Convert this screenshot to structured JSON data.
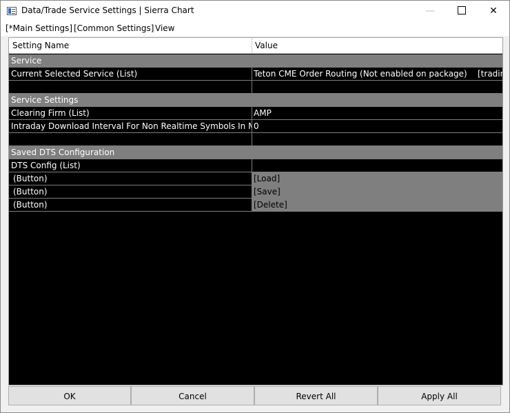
{
  "window": {
    "title": "Data/Trade Service Settings | Sierra Chart"
  },
  "menu": {
    "main_settings": "[*Main Settings]",
    "common_settings": "[Common Settings]",
    "view": "View"
  },
  "grid": {
    "header": {
      "setting_name": "Setting Name",
      "value": "Value"
    },
    "sections": {
      "service": "Service",
      "service_settings": "Service Settings",
      "saved_dts": "Saved DTS Configuration"
    },
    "rows": {
      "current_service": {
        "name": "Current Selected Service (List)",
        "value": "Teton CME Order Routing (Not enabled on package)    [trading]"
      },
      "clearing_firm": {
        "name": "Clearing Firm (List)",
        "value": "AMP"
      },
      "download_interval": {
        "name": "Intraday Download Interval For Non Realtime Symbols In Minutes",
        "value": "0"
      },
      "dts_config": {
        "name": "DTS Config (List)",
        "value": ""
      },
      "load": {
        "name": "(Button)",
        "value": "[Load]"
      },
      "save": {
        "name": "(Button)",
        "value": "[Save]"
      },
      "delete": {
        "name": "(Button)",
        "value": "[Delete]"
      }
    }
  },
  "buttons": {
    "ok": "OK",
    "cancel": "Cancel",
    "revert_all": "Revert All",
    "apply_all": "Apply All"
  },
  "colors": {
    "section_bg": "#7f7f7f",
    "grid_bg": "#000000",
    "text_light": "#ffffff"
  }
}
